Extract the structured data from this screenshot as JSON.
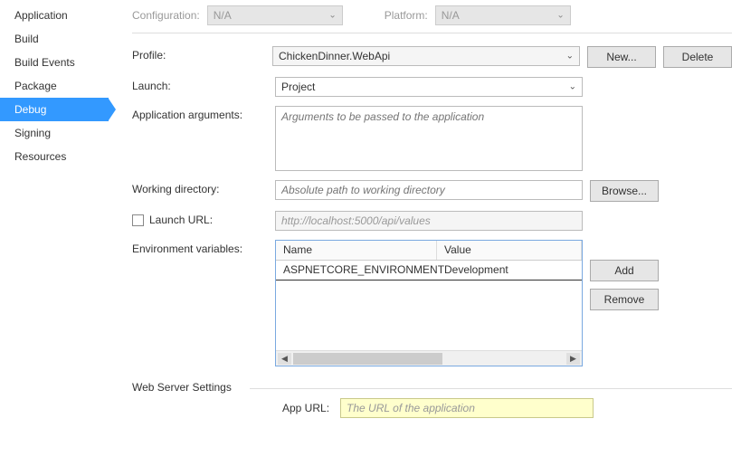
{
  "sidebar": {
    "items": [
      {
        "label": "Application"
      },
      {
        "label": "Build"
      },
      {
        "label": "Build Events"
      },
      {
        "label": "Package"
      },
      {
        "label": "Debug"
      },
      {
        "label": "Signing"
      },
      {
        "label": "Resources"
      }
    ],
    "active_index": 4
  },
  "top": {
    "config_label": "Configuration:",
    "config_value": "N/A",
    "platform_label": "Platform:",
    "platform_value": "N/A"
  },
  "form": {
    "profile_label": "Profile:",
    "profile_value": "ChickenDinner.WebApi",
    "new_btn": "New...",
    "delete_btn": "Delete",
    "launch_label": "Launch:",
    "launch_value": "Project",
    "args_label": "Application arguments:",
    "args_placeholder": "Arguments to be passed to the application",
    "workdir_label": "Working directory:",
    "workdir_placeholder": "Absolute path to working directory",
    "browse_btn": "Browse...",
    "launchurl_label": "Launch URL:",
    "launchurl_value": "http://localhost:5000/api/values",
    "env_label": "Environment variables:",
    "env_name_header": "Name",
    "env_value_header": "Value",
    "env_rows": [
      {
        "name": "ASPNETCORE_ENVIRONMENT",
        "value": "Development"
      }
    ],
    "add_btn": "Add",
    "remove_btn": "Remove",
    "web_section": "Web Server Settings",
    "appurl_label": "App URL:",
    "appurl_placeholder": "The URL of the application"
  }
}
